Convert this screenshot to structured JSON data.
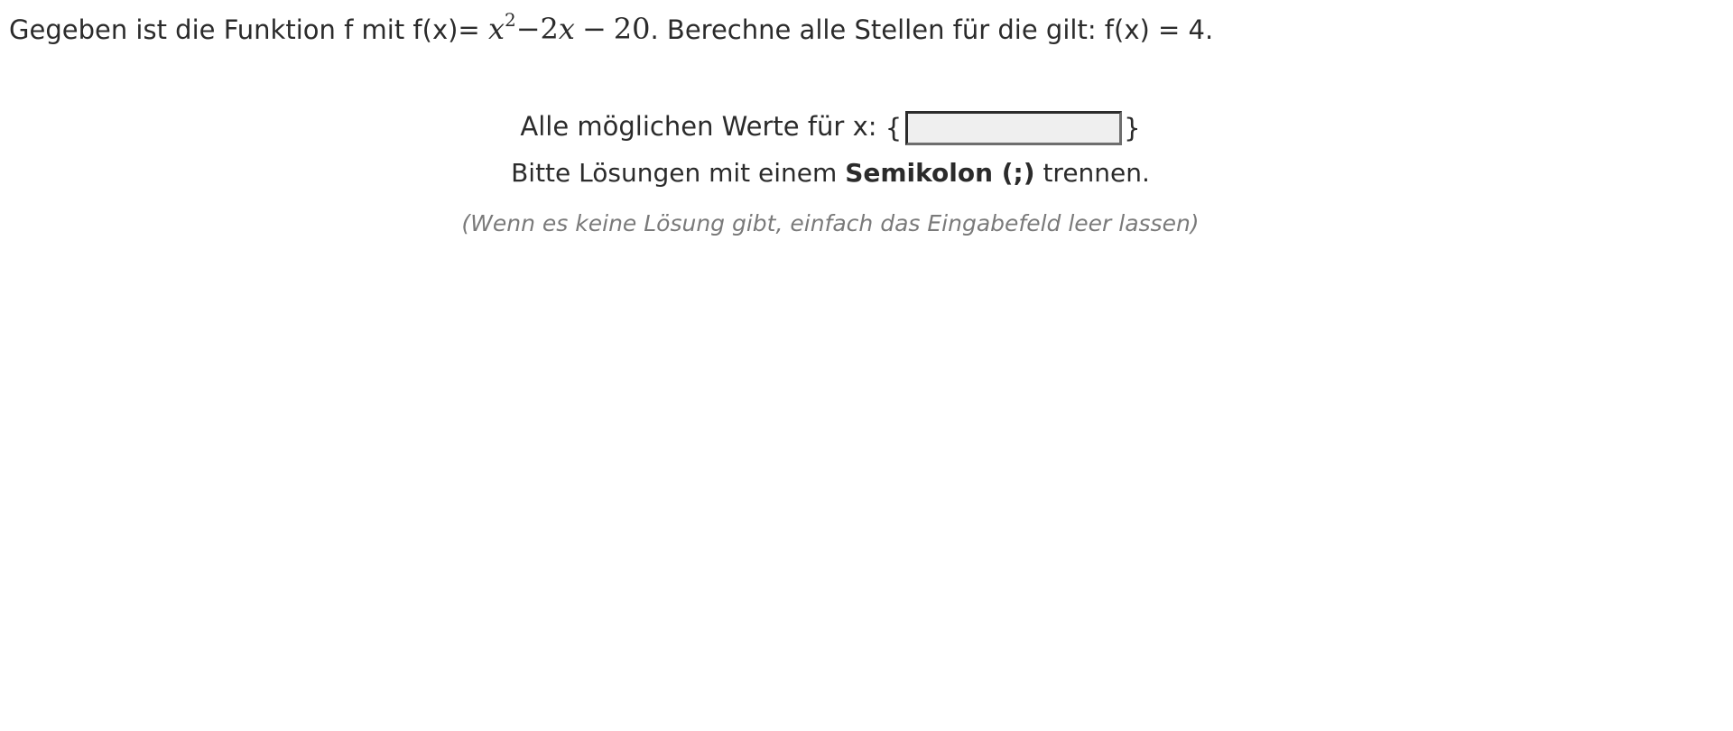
{
  "task": {
    "prefix": "Gegeben ist die Funktion f mit f(x)=",
    "formula": {
      "base": "x",
      "exponent": "2",
      "minus1": "−",
      "term2": "2",
      "var2": "x",
      "minus2": "−",
      "constant": "20"
    },
    "suffix": ". Berechne alle Stellen für die gilt: f(x) = 4."
  },
  "answer": {
    "label": "Alle möglichen Werte für x:",
    "open_brace": "{",
    "close_brace": "}",
    "value": "",
    "placeholder": ""
  },
  "hint": {
    "before": "Bitte Lösungen mit einem ",
    "bold": "Semikolon (;)",
    "after": " trennen."
  },
  "note": "(Wenn es keine Lösung gibt, einfach das Eingabefeld leer lassen)"
}
